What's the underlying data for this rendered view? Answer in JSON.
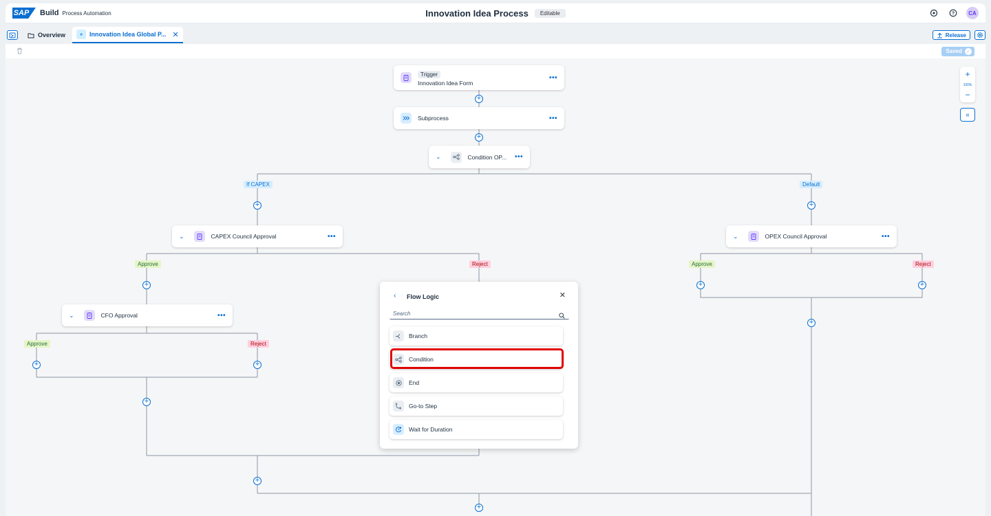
{
  "shell": {
    "logo": "SAP",
    "brand": "Build",
    "brand_sub": "Process Automation",
    "process_title": "Innovation Idea Process",
    "edit_badge": "Editable",
    "avatar": "CA"
  },
  "tabs": {
    "overview": "Overview",
    "active": "Innovation Idea Global P...",
    "release": "Release"
  },
  "toolbar": {
    "saved": "Saved"
  },
  "zoom": {
    "plus": "+",
    "level": "100%",
    "minus": "−"
  },
  "flow": {
    "trigger_tag": "Trigger",
    "trigger_name": "Innovation Idea Form",
    "subprocess": "Subprocess",
    "condition": "Condition OP...",
    "branch_capex": "If CAPEX",
    "branch_default": "Default",
    "capex_approval": "CAPEX Council Approval",
    "opex_approval": "OPEX Council Approval",
    "cfo_approval": "CFO Approval",
    "approve": "Approve",
    "reject": "Reject"
  },
  "popover": {
    "title": "Flow Logic",
    "search_placeholder": "Search",
    "items": [
      "Branch",
      "Condition",
      "End",
      "Go-to Step",
      "Wait for Duration"
    ]
  },
  "colors": {
    "accent": "#0a6ed1",
    "highlight": "#e00000"
  }
}
